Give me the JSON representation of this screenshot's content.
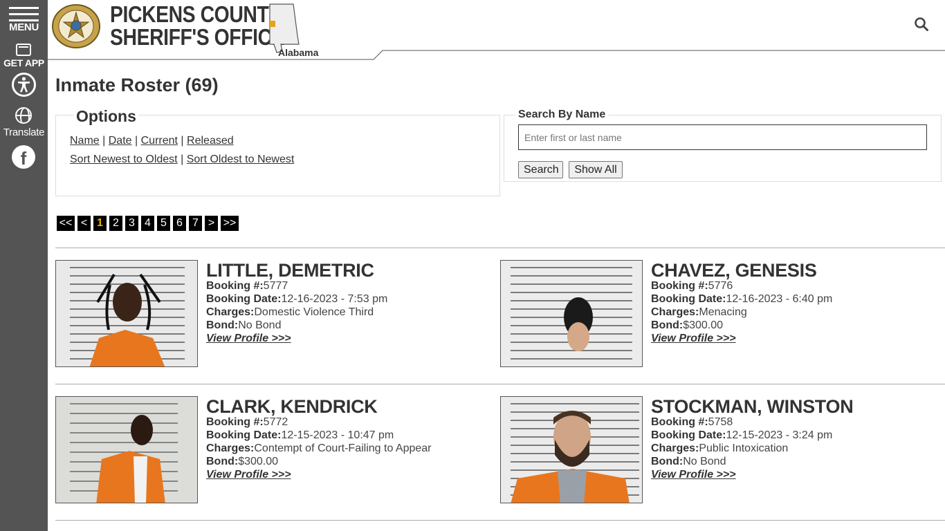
{
  "sidebar": {
    "menu_label": "MENU",
    "app_label": "GET APP",
    "translate_label": "Translate",
    "facebook_glyph": "f"
  },
  "header": {
    "title_line1": "PICKENS COUNTY",
    "title_line2": "SHERIFF'S OFFICE",
    "state_label": "Alabama"
  },
  "page": {
    "title": "Inmate Roster (69)"
  },
  "options": {
    "legend": "Options",
    "links": [
      "Name",
      "Date",
      "Current",
      "Released"
    ],
    "sort_links": [
      "Sort Newest to Oldest",
      "Sort Oldest to Newest"
    ],
    "separator": "|"
  },
  "search": {
    "legend": "Search By Name",
    "placeholder": "Enter first or last name",
    "search_label": "Search",
    "show_all_label": "Show All"
  },
  "pager": {
    "items": [
      "<<",
      "<",
      "1",
      "2",
      "3",
      "4",
      "5",
      "6",
      "7",
      ">",
      ">>"
    ],
    "current": "1"
  },
  "inmates": [
    {
      "name": "LITTLE, DEMETRIC",
      "booking_label": "Booking #:",
      "booking": "5777",
      "date_label": "Booking Date:",
      "date": "12-16-2023 - 7:53 pm",
      "charges_label": "Charges:",
      "charges": "Domestic Violence Third",
      "bond_label": "Bond:",
      "bond": "No Bond",
      "link": "View Profile >>>"
    },
    {
      "name": "CHAVEZ, GENESIS",
      "booking_label": "Booking #:",
      "booking": "5776",
      "date_label": "Booking Date:",
      "date": "12-16-2023 - 6:40 pm",
      "charges_label": "Charges:",
      "charges": "Menacing",
      "bond_label": "Bond:",
      "bond": "$300.00",
      "link": "View Profile >>>"
    },
    {
      "name": "CLARK, KENDRICK",
      "booking_label": "Booking #:",
      "booking": "5772",
      "date_label": "Booking Date:",
      "date": "12-15-2023 - 10:47 pm",
      "charges_label": "Charges:",
      "charges": "Contempt of Court-Failing to Appear",
      "bond_label": "Bond:",
      "bond": "$300.00",
      "link": "View Profile >>>"
    },
    {
      "name": "STOCKMAN, WINSTON",
      "booking_label": "Booking #:",
      "booking": "5758",
      "date_label": "Booking Date:",
      "date": "12-15-2023 - 3:24 pm",
      "charges_label": "Charges:",
      "charges": "Public Intoxication",
      "bond_label": "Bond:",
      "bond": "No Bond",
      "link": "View Profile >>>"
    }
  ],
  "colors": {
    "sidebar_bg": "#545454",
    "pager_bg": "#000000",
    "pager_active": "#f0b400",
    "jumpsuit": "#e8761e"
  }
}
